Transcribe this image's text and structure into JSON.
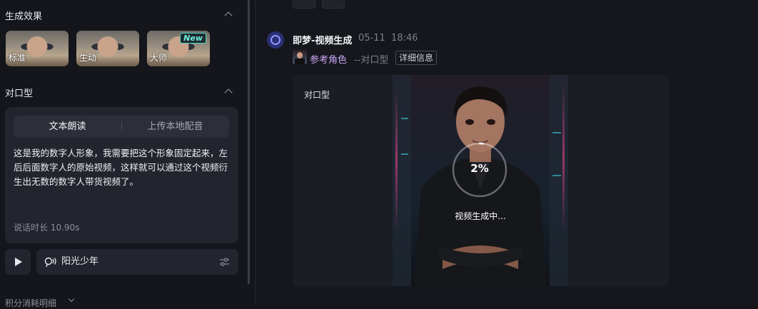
{
  "left_panel": {
    "effects_section": {
      "title": "生成效果",
      "options": [
        {
          "label": "标准",
          "selected": false
        },
        {
          "label": "生动",
          "selected": false
        },
        {
          "label": "大师",
          "selected": true,
          "badge": "New"
        }
      ]
    },
    "lipsync_section": {
      "title": "对口型",
      "tabs": [
        {
          "label": "文本朗读",
          "active": true
        },
        {
          "label": "上传本地配音",
          "active": false
        }
      ],
      "script_text": "这是我的数字人形象，我需要把这个形象固定起来，左后后面数字人的原始视频，这样就可以通过这个视频衍生出无数的数字人带货视频了。",
      "duration": "说话时长 10.90s"
    },
    "voice": {
      "play_icon": "play-icon",
      "voice_icon": "voice-speaker-icon",
      "name": "阳光少年",
      "settings_icon": "sliders-icon"
    },
    "points_detail": "积分消耗明细"
  },
  "chat": {
    "sender": "即梦-视频生成",
    "date": "05-11",
    "time": "18:46",
    "reference_label": "参考角色",
    "reference_type": "--对口型",
    "detail_button": "详细信息",
    "result_type": "对口型",
    "progress_text": "2%",
    "progress_value": 0.02,
    "status_text": "视频生成中..."
  },
  "colors": {
    "background": "#14161b",
    "card": "#22252d",
    "accent_purple": "#c9a6f2",
    "new_badge": "#49d8c6"
  }
}
